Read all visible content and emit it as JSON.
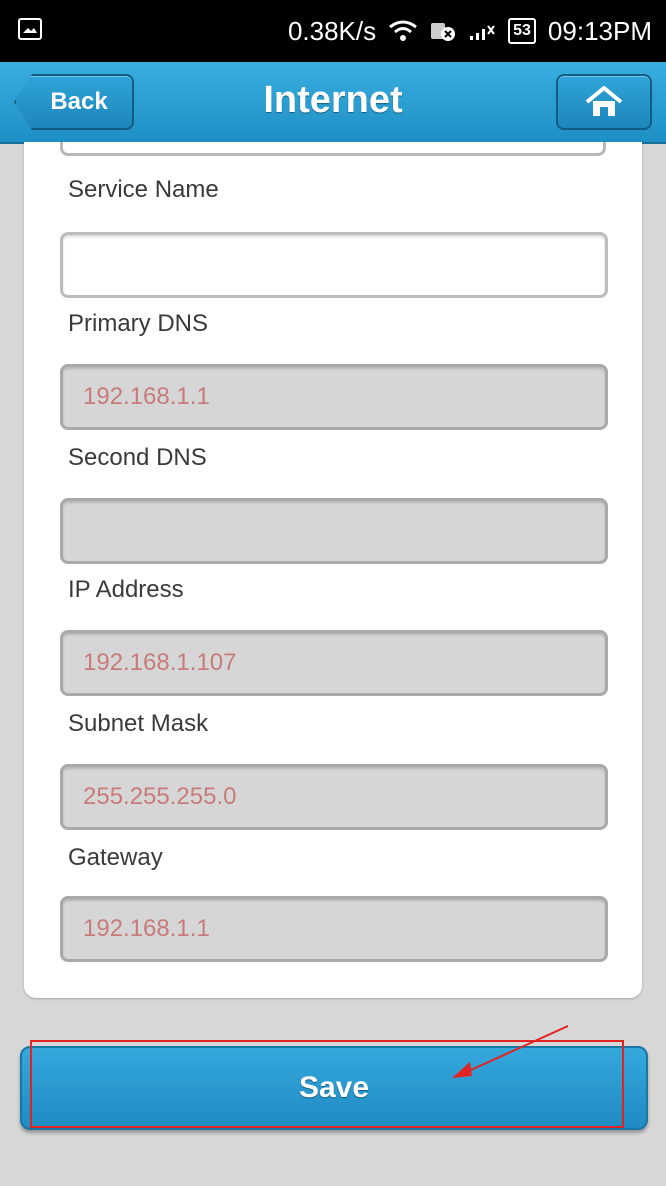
{
  "status_bar": {
    "net_speed": "0.38K/s",
    "battery": "53",
    "time": "09:13PM"
  },
  "header": {
    "back_label": "Back",
    "title": "Internet",
    "home_icon": "home-icon"
  },
  "form": {
    "fields": [
      {
        "label": "Service Name",
        "value": "",
        "editable": true
      },
      {
        "label": "Primary DNS",
        "value": "192.168.1.1",
        "editable": false
      },
      {
        "label": "Second DNS",
        "value": "",
        "editable": false
      },
      {
        "label": "IP Address",
        "value": "192.168.1.107",
        "editable": false
      },
      {
        "label": "Subnet Mask",
        "value": "255.255.255.0",
        "editable": false
      },
      {
        "label": "Gateway",
        "value": "192.168.1.1",
        "editable": false
      }
    ]
  },
  "actions": {
    "save_label": "Save"
  },
  "colors": {
    "header": "#2a9fd6",
    "readonly_text": "#c87b7b",
    "annotation": "#e12323"
  }
}
